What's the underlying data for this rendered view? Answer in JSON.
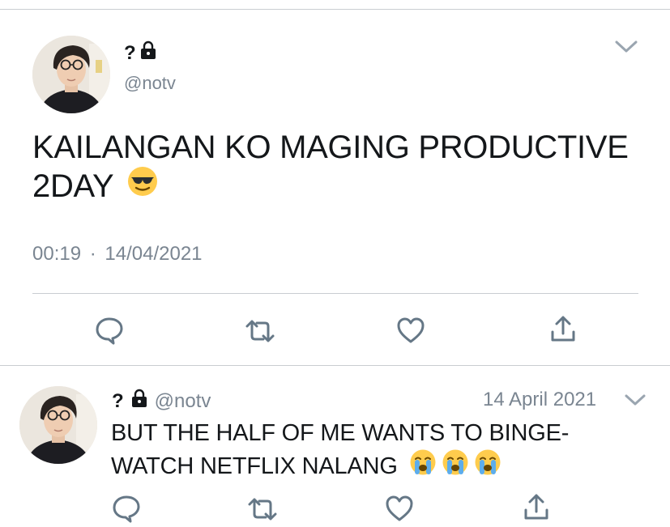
{
  "tweet1": {
    "name": "?",
    "handle": "@notv",
    "text": "KAILANGAN KO MAGING PRODUCTIVE 2DAY",
    "text_emoji": "smiling-face-with-sunglasses",
    "time": "00:19",
    "separator": "·",
    "date": "14/04/2021",
    "icons": {
      "more": "chevron-down-icon",
      "lock": "lock-icon",
      "reply": "reply-icon",
      "retweet": "retweet-icon",
      "like": "heart-icon",
      "share": "share-icon"
    }
  },
  "tweet2": {
    "name": "?",
    "handle": "@notv",
    "date": "14 April 2021",
    "text_line1": "BUT THE HALF OF ME WANTS TO BINGE-",
    "text_line2": "WATCH NETFLIX NALANG",
    "text_emojis": [
      "loudly-crying-face",
      "loudly-crying-face",
      "loudly-crying-face"
    ]
  },
  "colors": {
    "text": "#14171a",
    "secondary": "#7a8591",
    "icon": "#657786",
    "divider": "#c9cdd1",
    "emoji_yellow": "#ffcc4d",
    "tear_blue": "#5dadec"
  }
}
